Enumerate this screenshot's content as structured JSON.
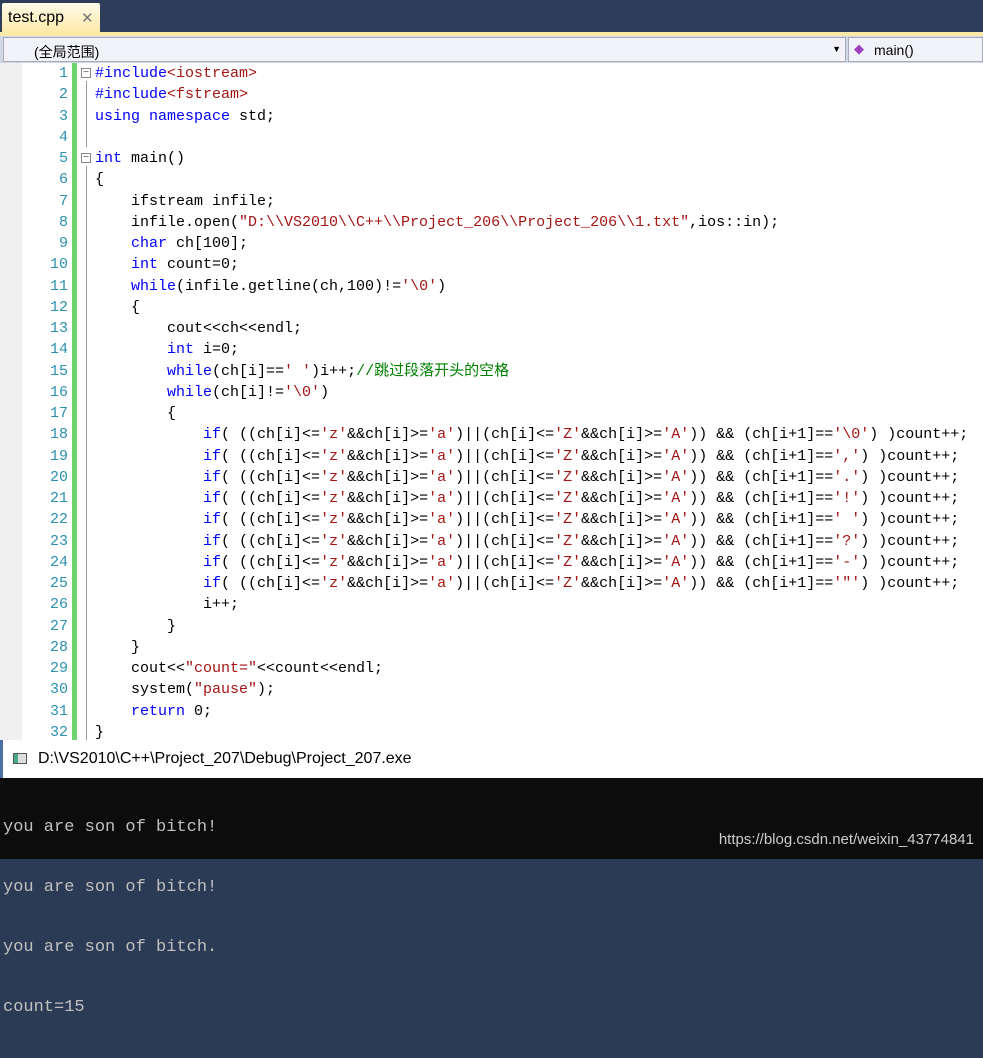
{
  "tab": {
    "title": "test.cpp",
    "close": "✕"
  },
  "nav": {
    "scope": "(全局范围)",
    "function": "main()",
    "function_icon": "method-icon"
  },
  "colors": {
    "keyword": "#0000ff",
    "string": "#a31515",
    "comment": "#008000",
    "line_number": "#2b91af"
  },
  "code": [
    [
      [
        "pp",
        "#include"
      ],
      [
        "st",
        "<iostream>"
      ]
    ],
    [
      [
        "pp",
        "#include"
      ],
      [
        "st",
        "<fstream>"
      ]
    ],
    [
      [
        "kw",
        "using"
      ],
      [
        "t",
        " "
      ],
      [
        "kw",
        "namespace"
      ],
      [
        "t",
        " std;"
      ]
    ],
    [],
    [
      [
        "kw",
        "int"
      ],
      [
        "t",
        " main()"
      ]
    ],
    [
      [
        "t",
        "{"
      ]
    ],
    [
      [
        "t",
        "    ifstream infile;"
      ]
    ],
    [
      [
        "t",
        "    infile.open("
      ],
      [
        "st",
        "\"D:\\\\VS2010\\\\C++\\\\Project_206\\\\Project_206\\\\1.txt\""
      ],
      [
        "t",
        ",ios::in);"
      ]
    ],
    [
      [
        "t",
        "    "
      ],
      [
        "kw",
        "char"
      ],
      [
        "t",
        " ch[100];"
      ]
    ],
    [
      [
        "t",
        "    "
      ],
      [
        "kw",
        "int"
      ],
      [
        "t",
        " count=0;"
      ]
    ],
    [
      [
        "t",
        "    "
      ],
      [
        "kw",
        "while"
      ],
      [
        "t",
        "(infile.getline(ch,100)!="
      ],
      [
        "st",
        "'\\0'"
      ],
      [
        "t",
        ")"
      ]
    ],
    [
      [
        "t",
        "    {"
      ]
    ],
    [
      [
        "t",
        "        cout<<ch<<endl;"
      ]
    ],
    [
      [
        "t",
        "        "
      ],
      [
        "kw",
        "int"
      ],
      [
        "t",
        " i=0;"
      ]
    ],
    [
      [
        "t",
        "        "
      ],
      [
        "kw",
        "while"
      ],
      [
        "t",
        "(ch[i]=="
      ],
      [
        "st",
        "' '"
      ],
      [
        "t",
        ")i++;"
      ],
      [
        "cm",
        "//跳过段落开头的空格"
      ]
    ],
    [
      [
        "t",
        "        "
      ],
      [
        "kw",
        "while"
      ],
      [
        "t",
        "(ch[i]!="
      ],
      [
        "st",
        "'\\0'"
      ],
      [
        "t",
        ")"
      ]
    ],
    [
      [
        "t",
        "        {"
      ]
    ],
    [
      [
        "t",
        "            "
      ],
      [
        "kw",
        "if"
      ],
      [
        "t",
        "( ((ch[i]<="
      ],
      [
        "st",
        "'z'"
      ],
      [
        "t",
        "&&ch[i]>="
      ],
      [
        "st",
        "'a'"
      ],
      [
        "t",
        ")||(ch[i]<="
      ],
      [
        "st",
        "'Z'"
      ],
      [
        "t",
        "&&ch[i]>="
      ],
      [
        "st",
        "'A'"
      ],
      [
        "t",
        ")) && (ch[i+1]=="
      ],
      [
        "st",
        "'\\0'"
      ],
      [
        "t",
        ") )count++;"
      ]
    ],
    [
      [
        "t",
        "            "
      ],
      [
        "kw",
        "if"
      ],
      [
        "t",
        "( ((ch[i]<="
      ],
      [
        "st",
        "'z'"
      ],
      [
        "t",
        "&&ch[i]>="
      ],
      [
        "st",
        "'a'"
      ],
      [
        "t",
        ")||(ch[i]<="
      ],
      [
        "st",
        "'Z'"
      ],
      [
        "t",
        "&&ch[i]>="
      ],
      [
        "st",
        "'A'"
      ],
      [
        "t",
        ")) && (ch[i+1]=="
      ],
      [
        "st",
        "','"
      ],
      [
        "t",
        ") )count++;"
      ]
    ],
    [
      [
        "t",
        "            "
      ],
      [
        "kw",
        "if"
      ],
      [
        "t",
        "( ((ch[i]<="
      ],
      [
        "st",
        "'z'"
      ],
      [
        "t",
        "&&ch[i]>="
      ],
      [
        "st",
        "'a'"
      ],
      [
        "t",
        ")||(ch[i]<="
      ],
      [
        "st",
        "'Z'"
      ],
      [
        "t",
        "&&ch[i]>="
      ],
      [
        "st",
        "'A'"
      ],
      [
        "t",
        ")) && (ch[i+1]=="
      ],
      [
        "st",
        "'.'"
      ],
      [
        "t",
        ") )count++;"
      ]
    ],
    [
      [
        "t",
        "            "
      ],
      [
        "kw",
        "if"
      ],
      [
        "t",
        "( ((ch[i]<="
      ],
      [
        "st",
        "'z'"
      ],
      [
        "t",
        "&&ch[i]>="
      ],
      [
        "st",
        "'a'"
      ],
      [
        "t",
        ")||(ch[i]<="
      ],
      [
        "st",
        "'Z'"
      ],
      [
        "t",
        "&&ch[i]>="
      ],
      [
        "st",
        "'A'"
      ],
      [
        "t",
        ")) && (ch[i+1]=="
      ],
      [
        "st",
        "'!'"
      ],
      [
        "t",
        ") )count++;"
      ]
    ],
    [
      [
        "t",
        "            "
      ],
      [
        "kw",
        "if"
      ],
      [
        "t",
        "( ((ch[i]<="
      ],
      [
        "st",
        "'z'"
      ],
      [
        "t",
        "&&ch[i]>="
      ],
      [
        "st",
        "'a'"
      ],
      [
        "t",
        ")||(ch[i]<="
      ],
      [
        "st",
        "'Z'"
      ],
      [
        "t",
        "&&ch[i]>="
      ],
      [
        "st",
        "'A'"
      ],
      [
        "t",
        ")) && (ch[i+1]=="
      ],
      [
        "st",
        "' '"
      ],
      [
        "t",
        ") )count++;"
      ]
    ],
    [
      [
        "t",
        "            "
      ],
      [
        "kw",
        "if"
      ],
      [
        "t",
        "( ((ch[i]<="
      ],
      [
        "st",
        "'z'"
      ],
      [
        "t",
        "&&ch[i]>="
      ],
      [
        "st",
        "'a'"
      ],
      [
        "t",
        ")||(ch[i]<="
      ],
      [
        "st",
        "'Z'"
      ],
      [
        "t",
        "&&ch[i]>="
      ],
      [
        "st",
        "'A'"
      ],
      [
        "t",
        ")) && (ch[i+1]=="
      ],
      [
        "st",
        "'?'"
      ],
      [
        "t",
        ") )count++;"
      ]
    ],
    [
      [
        "t",
        "            "
      ],
      [
        "kw",
        "if"
      ],
      [
        "t",
        "( ((ch[i]<="
      ],
      [
        "st",
        "'z'"
      ],
      [
        "t",
        "&&ch[i]>="
      ],
      [
        "st",
        "'a'"
      ],
      [
        "t",
        ")||(ch[i]<="
      ],
      [
        "st",
        "'Z'"
      ],
      [
        "t",
        "&&ch[i]>="
      ],
      [
        "st",
        "'A'"
      ],
      [
        "t",
        ")) && (ch[i+1]=="
      ],
      [
        "st",
        "'-'"
      ],
      [
        "t",
        ") )count++;"
      ]
    ],
    [
      [
        "t",
        "            "
      ],
      [
        "kw",
        "if"
      ],
      [
        "t",
        "( ((ch[i]<="
      ],
      [
        "st",
        "'z'"
      ],
      [
        "t",
        "&&ch[i]>="
      ],
      [
        "st",
        "'a'"
      ],
      [
        "t",
        ")||(ch[i]<="
      ],
      [
        "st",
        "'Z'"
      ],
      [
        "t",
        "&&ch[i]>="
      ],
      [
        "st",
        "'A'"
      ],
      [
        "t",
        ")) && (ch[i+1]=="
      ],
      [
        "st",
        "'\"'"
      ],
      [
        "t",
        ") )count++;"
      ]
    ],
    [
      [
        "t",
        "            i++;"
      ]
    ],
    [
      [
        "t",
        "        }"
      ]
    ],
    [
      [
        "t",
        "    }"
      ]
    ],
    [
      [
        "t",
        "    cout<<"
      ],
      [
        "st",
        "\"count=\""
      ],
      [
        "t",
        "<<count<<endl;"
      ]
    ],
    [
      [
        "t",
        "    system("
      ],
      [
        "st",
        "\"pause\""
      ],
      [
        "t",
        ");"
      ]
    ],
    [
      [
        "t",
        "    "
      ],
      [
        "kw",
        "return"
      ],
      [
        "t",
        " 0;"
      ]
    ],
    [
      [
        "t",
        "}"
      ]
    ]
  ],
  "console": {
    "title": "D:\\VS2010\\C++\\Project_207\\Debug\\Project_207.exe",
    "lines": [
      "you are son of bitch!",
      "you are son of bitch!",
      "you are son of bitch.",
      "count=15"
    ],
    "watermark": "https://blog.csdn.net/weixin_43774841"
  }
}
